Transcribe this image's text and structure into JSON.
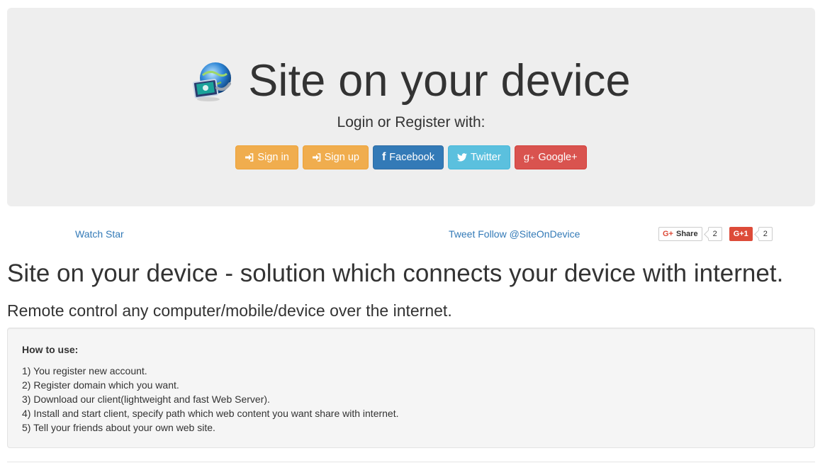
{
  "hero": {
    "title": "Site on your device",
    "login_prompt": "Login or Register with:",
    "buttons": [
      {
        "label": "Sign in",
        "icon": "sign-in-icon",
        "style": "warning"
      },
      {
        "label": "Sign up",
        "icon": "sign-in-icon",
        "style": "warning"
      },
      {
        "label": "Facebook",
        "icon": "facebook-icon",
        "style": "primary"
      },
      {
        "label": "Twitter",
        "icon": "twitter-icon",
        "style": "info"
      },
      {
        "label": "Google+",
        "icon": "google-plus-icon",
        "style": "danger"
      }
    ]
  },
  "social": {
    "github_text": "Watch Star",
    "twitter_text": "Tweet Follow @SiteOnDevice",
    "gplus_share_label": "Share",
    "gplus_share_count": "2",
    "gplus_plus_one_label": "G+1",
    "gplus_plus_one_count": "2"
  },
  "main": {
    "heading": "Site on your device - solution which connects your device with internet.",
    "subheading": "Remote control any computer/mobile/device over the internet."
  },
  "how_to": {
    "title": "How to use:",
    "steps": [
      "1) You register new account.",
      "2) Register domain which you want.",
      "3) Download our client(lightweight and fast Web Server).",
      "4) Install and start client, specify path which web content you want share with internet.",
      "5) Tell your friends about your own web site."
    ]
  },
  "colors": {
    "jumbotron_bg": "#eeeeee",
    "warning": "#f0ad4e",
    "primary": "#337ab7",
    "info": "#5bc0de",
    "danger": "#d9534f",
    "link": "#337ab7"
  }
}
